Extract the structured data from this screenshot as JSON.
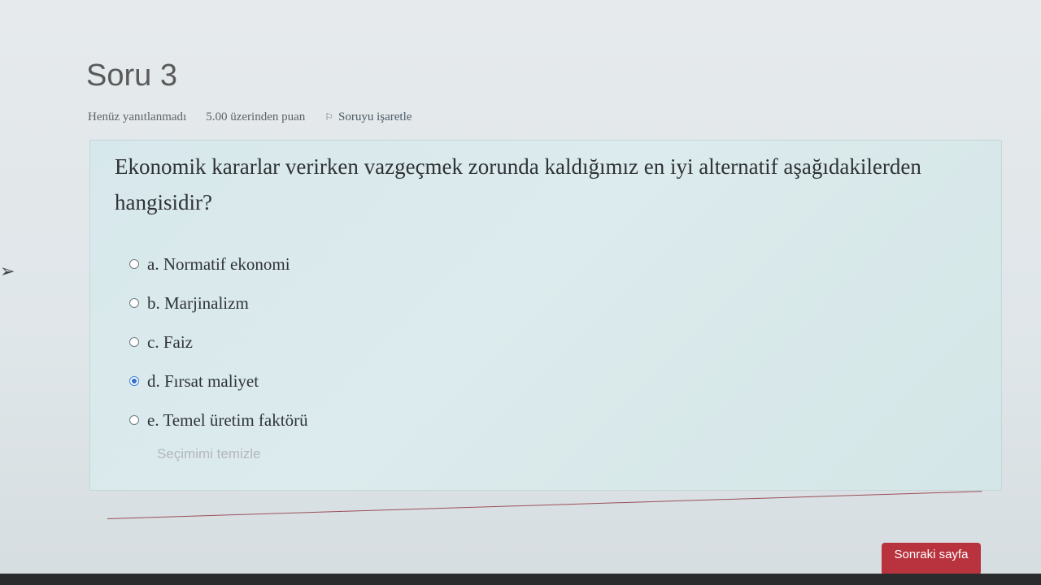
{
  "question": {
    "title": "Soru 3",
    "status": "Henüz yanıtlanmadı",
    "points": "5.00 üzerinden puan",
    "flag_label": "Soruyu işaretle",
    "text": "Ekonomik kararlar verirken vazgeçmek zorunda kaldığımız en iyi alternatif aşağıdakilerden hangisidir?",
    "answers": [
      {
        "label": "a. Normatif ekonomi",
        "selected": false
      },
      {
        "label": "b. Marjinalizm",
        "selected": false
      },
      {
        "label": "c. Faiz",
        "selected": false
      },
      {
        "label": "d. Fırsat maliyet",
        "selected": true
      },
      {
        "label": "e. Temel üretim faktörü",
        "selected": false
      }
    ],
    "clear_label": "Seçimimi temizle"
  },
  "navigation": {
    "next_label": "Sonraki sayfa"
  },
  "colors": {
    "accent": "#2f6fd0",
    "button": "#b9333e"
  }
}
